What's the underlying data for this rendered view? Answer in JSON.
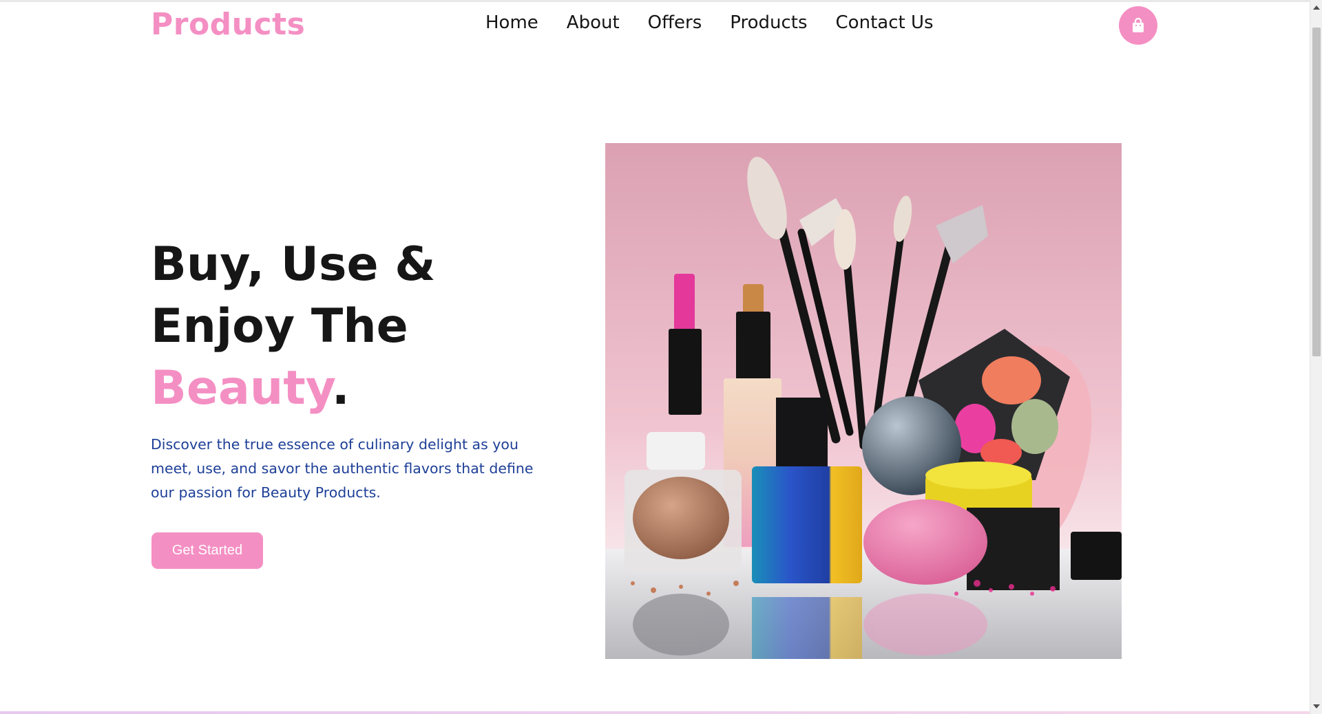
{
  "brand": {
    "logo": "Products"
  },
  "nav": {
    "items": [
      {
        "label": "Home"
      },
      {
        "label": "About"
      },
      {
        "label": "Offers"
      },
      {
        "label": "Products"
      },
      {
        "label": "Contact Us"
      }
    ]
  },
  "cart": {
    "icon": "shopping-bag-icon"
  },
  "hero": {
    "title_line1": "Buy, Use &",
    "title_line2": "Enjoy The",
    "title_accent": "Beauty",
    "title_end": ".",
    "description": "Discover the true essence of culinary delight as you meet, use, and savor the authentic flavors that define our passion for Beauty Products.",
    "cta_label": "Get Started",
    "image": "cosmetics-product-photo"
  },
  "colors": {
    "accent": "#f48fc3",
    "text": "#161616",
    "description": "#1d3f97"
  }
}
